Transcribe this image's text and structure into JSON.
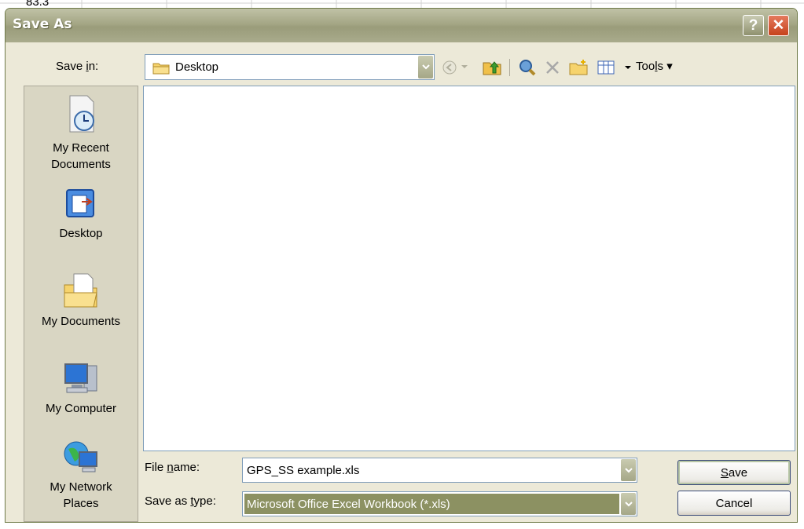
{
  "background": {
    "cell_text": "83.3"
  },
  "dialog": {
    "title": "Save As",
    "help_label": "?",
    "close_label": "✕",
    "save_in": {
      "label_pre": "Save ",
      "label_u": "i",
      "label_post": "n:",
      "value": "Desktop"
    },
    "toolbar": {
      "tools_pre": "Too",
      "tools_u": "l",
      "tools_post": "s"
    },
    "places": [
      {
        "label_line1": "My Recent",
        "label_line2": "Documents",
        "icon": "recent-documents-icon"
      },
      {
        "label_line1": "Desktop",
        "label_line2": "",
        "icon": "desktop-icon"
      },
      {
        "label_line1": "My Documents",
        "label_line2": "",
        "icon": "my-documents-icon"
      },
      {
        "label_line1": "My Computer",
        "label_line2": "",
        "icon": "my-computer-icon"
      },
      {
        "label_line1": "My Network",
        "label_line2": "Places",
        "icon": "network-places-icon"
      }
    ],
    "file_name": {
      "label_pre": "File ",
      "label_u": "n",
      "label_post": "ame:",
      "value": "GPS_SS example.xls"
    },
    "save_as_type": {
      "label_pre": "Save as ",
      "label_u": "t",
      "label_post": "ype:",
      "value": "Microsoft Office Excel Workbook (*.xls)"
    },
    "save_button": {
      "label_u": "S",
      "label_post": "ave"
    },
    "cancel_button": {
      "label": "Cancel"
    }
  },
  "colors": {
    "dialog_bg": "#ece9d8",
    "title_bar": "#a4a685",
    "close_red": "#c6421c",
    "selection_olive": "#8c9162"
  }
}
